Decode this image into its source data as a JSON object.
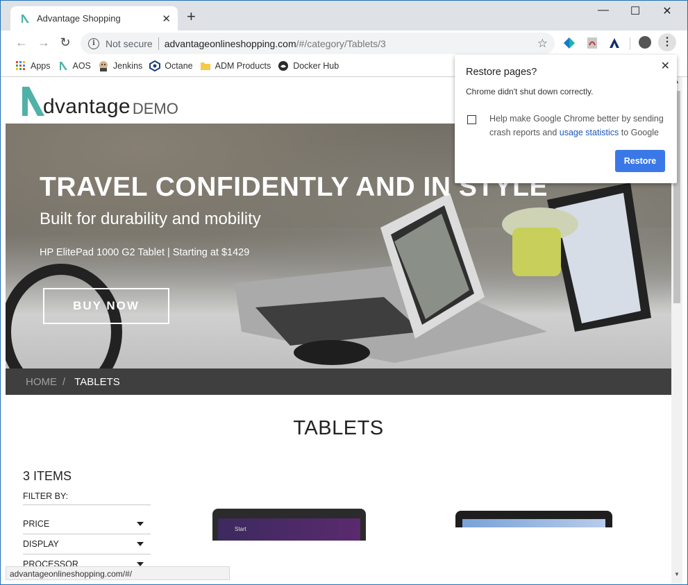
{
  "browser": {
    "tab_title": "Advantage Shopping",
    "new_tab": "+",
    "url_prefix": "Not secure",
    "url_host": "advantageonlineshopping.com",
    "url_path": "/#/category/Tablets/3"
  },
  "bookmarks": [
    {
      "label": "Apps"
    },
    {
      "label": "AOS"
    },
    {
      "label": "Jenkins"
    },
    {
      "label": "Octane"
    },
    {
      "label": "ADM Products"
    },
    {
      "label": "Docker Hub"
    }
  ],
  "site": {
    "brand": "dvantage",
    "demo": "DEMO",
    "hero": {
      "headline": "TRAVEL CONFIDENTLY AND IN STYLE",
      "subheadline": "Built for durability and mobility",
      "product_line": "HP ElitePad 1000 G2 Tablet | Starting at $1429",
      "cta": "BUY NOW"
    },
    "breadcrumb": {
      "home": "HOME",
      "separator": "/",
      "current": "TABLETS"
    },
    "category_title": "TABLETS",
    "items_count": "3 ITEMS",
    "filter_by": "FILTER BY:",
    "filters": [
      "PRICE",
      "DISPLAY",
      "PROCESSOR"
    ],
    "product_screen_text": "Start"
  },
  "status_bar": "advantageonlineshopping.com/#/",
  "popup": {
    "title": "Restore pages?",
    "message": "Chrome didn't shut down correctly.",
    "checkbox_text_before": "Help make Google Chrome better by sending crash reports and",
    "checkbox_link": "usage statistics",
    "checkbox_text_after": "to Google",
    "restore_label": "Restore"
  },
  "colors": {
    "brand_teal": "#4fb1a7",
    "button_blue": "#3b78e7",
    "breadcrumb_bg": "#3f3f3f"
  }
}
